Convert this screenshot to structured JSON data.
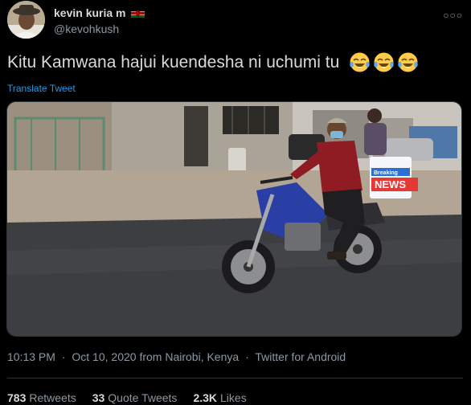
{
  "author": {
    "name": "kevin kuria m",
    "handle": "@kevohkush",
    "flag_icon": "kenya-flag-icon",
    "avatar_icon": "profile-avatar"
  },
  "tweet": {
    "text": "Kitu Kamwana hajui kuendesha ni uchumi tu",
    "emoji": [
      "😂",
      "😂",
      "😂"
    ],
    "translate_label": "Translate Tweet"
  },
  "media": {
    "description_icon": "photo-man-on-motorbike",
    "badge_top": "Breaking",
    "badge_bottom": "NEWS"
  },
  "meta": {
    "time": "10:13 PM",
    "date": "Oct 10, 2020",
    "location": "from Nairobi, Kenya",
    "client": "Twitter for Android",
    "separator": "·"
  },
  "stats": {
    "retweets_count": "783",
    "retweets_label": "Retweets",
    "quotes_count": "33",
    "quotes_label": "Quote Tweets",
    "likes_count": "2.3K",
    "likes_label": "Likes"
  },
  "colors": {
    "background": "#000000",
    "text": "#d9d9d9",
    "secondary": "#8b98a5",
    "link": "#1d9bf0",
    "border": "#2f3336"
  }
}
